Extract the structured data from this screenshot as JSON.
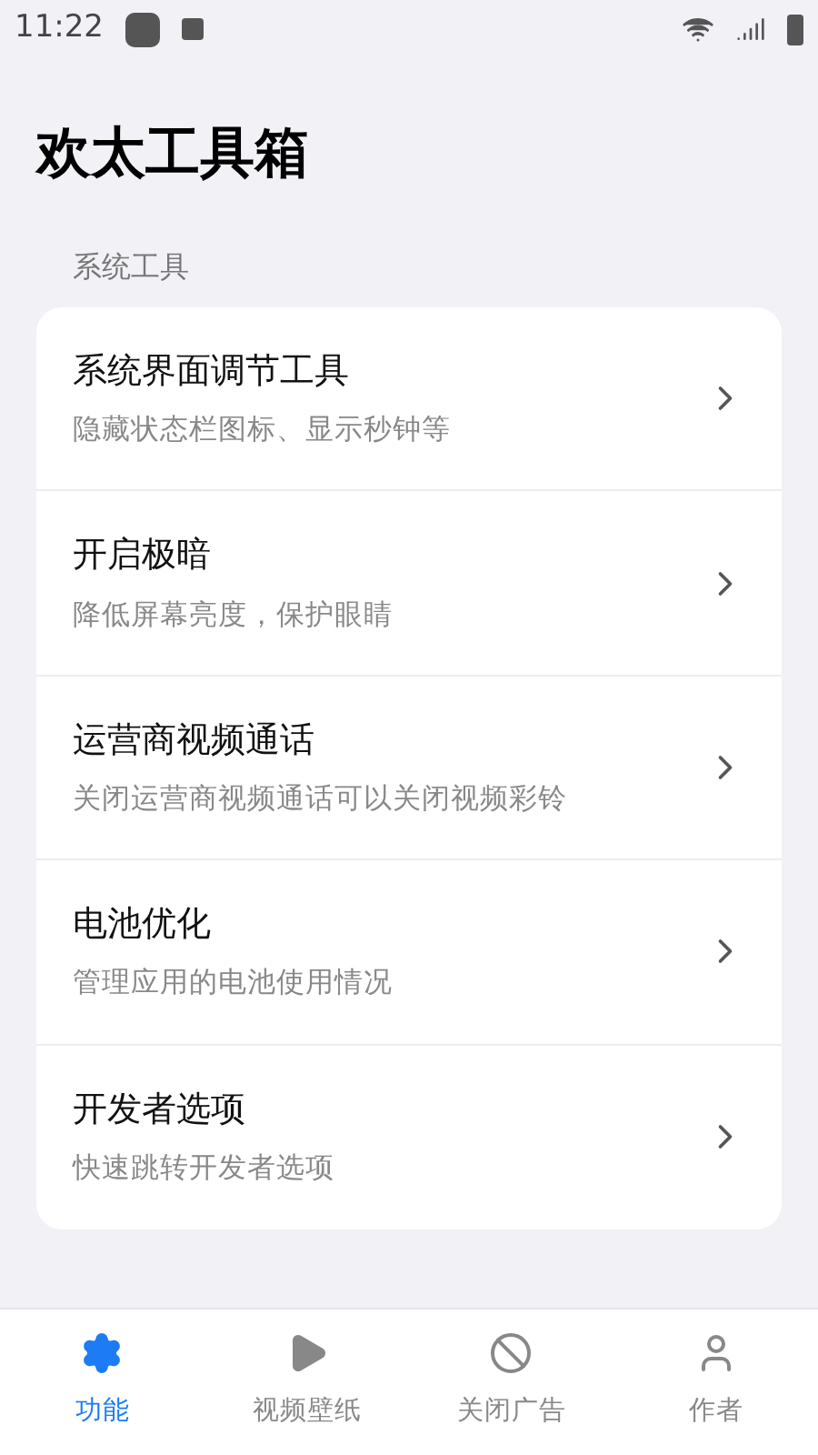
{
  "status_bar": {
    "time": "11:22"
  },
  "title": "欢太工具箱",
  "sections": [
    {
      "header": "系统工具",
      "items": [
        {
          "title": "系统界面调节工具",
          "subtitle": "隐藏状态栏图标、显示秒钟等"
        },
        {
          "title": "开启极暗",
          "subtitle": "降低屏幕亮度，保护眼睛"
        },
        {
          "title": "运营商视频通话",
          "subtitle": "关闭运营商视频通话可以关闭视频彩铃"
        },
        {
          "title": "电池优化",
          "subtitle": "管理应用的电池使用情况"
        },
        {
          "title": "开发者选项",
          "subtitle": "快速跳转开发者选项"
        }
      ]
    }
  ],
  "bottom_nav": [
    {
      "label": "功能",
      "kind": "gear",
      "selected": true
    },
    {
      "label": "视频壁纸",
      "kind": "play",
      "selected": false
    },
    {
      "label": "关闭广告",
      "kind": "ban",
      "selected": false
    },
    {
      "label": "作者",
      "kind": "user",
      "selected": false
    }
  ]
}
